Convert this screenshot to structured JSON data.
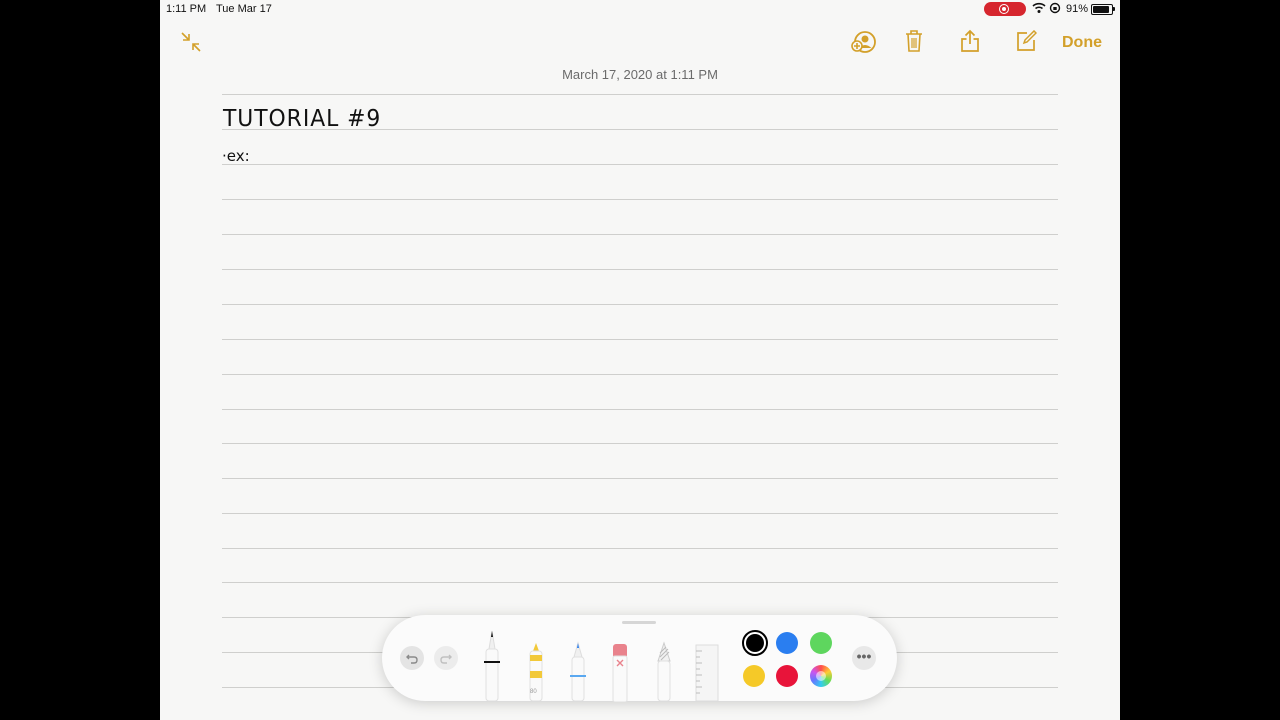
{
  "status_bar": {
    "time": "1:11 PM",
    "date": "Tue Mar 17",
    "battery_percent": "91%",
    "battery_level": 0.91,
    "recording": true
  },
  "toolbar": {
    "icons": [
      "collapse-icon",
      "add-person-icon",
      "trash-icon",
      "share-icon",
      "compose-icon"
    ],
    "done_label": "Done",
    "accent": "#d3a02a"
  },
  "note": {
    "timestamp": "March 17, 2020 at 1:11 PM",
    "handwriting": [
      "TUTORIAL #9",
      "·ex:"
    ]
  },
  "markup_palette": {
    "tools": [
      "undo-icon",
      "redo-icon",
      "pen-tool",
      "marker-tool",
      "pencil-tool",
      "eraser-tool",
      "lasso-tool",
      "ruler-tool"
    ],
    "marker_label": "80",
    "colors": [
      {
        "name": "black",
        "hex": "#000000",
        "selected": true
      },
      {
        "name": "blue",
        "hex": "#2a7ef0",
        "selected": false
      },
      {
        "name": "green",
        "hex": "#5ed65e",
        "selected": false
      },
      {
        "name": "yellow",
        "hex": "#f5c928",
        "selected": false
      },
      {
        "name": "red",
        "hex": "#e8143a",
        "selected": false
      },
      {
        "name": "color-picker",
        "hex": "multicolor",
        "selected": false
      }
    ],
    "more_label": "•••"
  }
}
